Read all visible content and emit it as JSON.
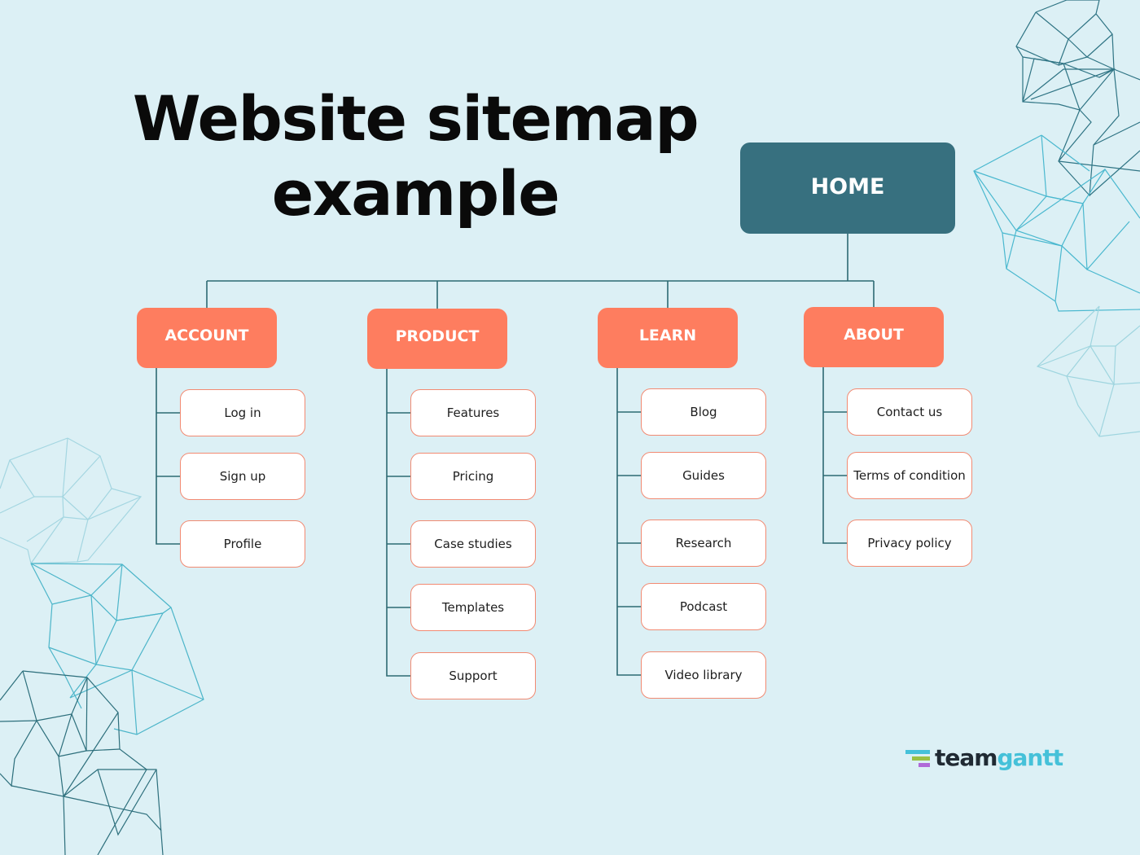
{
  "title": {
    "line1": "Website sitemap",
    "line2": "example"
  },
  "home": {
    "label": "HOME"
  },
  "colors": {
    "background": "#dcf0f5",
    "home": "#37707f",
    "category": "#fe7d5f",
    "page_border": "#f28a72",
    "connector": "#2d6a73"
  },
  "categories": [
    {
      "label": "ACCOUNT",
      "pages": [
        "Log in",
        "Sign up",
        "Profile"
      ]
    },
    {
      "label": "PRODUCT",
      "pages": [
        "Features",
        "Pricing",
        "Case studies",
        "Templates",
        "Support"
      ]
    },
    {
      "label": "LEARN",
      "pages": [
        "Blog",
        "Guides",
        "Research",
        "Podcast",
        "Video library"
      ]
    },
    {
      "label": "ABOUT",
      "pages": [
        "Contact us",
        "Terms of condition",
        "Privacy policy"
      ]
    }
  ],
  "logo": {
    "part1": "team",
    "part2": "gantt",
    "icon": "teamgantt-bars-icon"
  }
}
